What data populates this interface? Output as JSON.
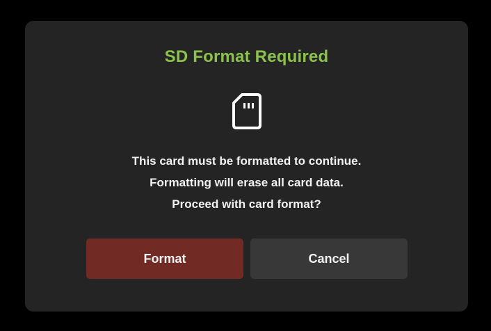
{
  "dialog": {
    "title": "SD Format Required",
    "icon": "sd-card-icon",
    "message_lines": [
      "This card must be formatted to continue.",
      "Formatting will erase all card data.",
      "Proceed with card format?"
    ],
    "buttons": {
      "format_label": "Format",
      "cancel_label": "Cancel"
    }
  },
  "colors": {
    "background": "#000000",
    "dialog_bg": "#242424",
    "title": "#8bc34a",
    "format_button": "#722a24",
    "cancel_button": "#383838",
    "text": "#f2f2f2"
  }
}
